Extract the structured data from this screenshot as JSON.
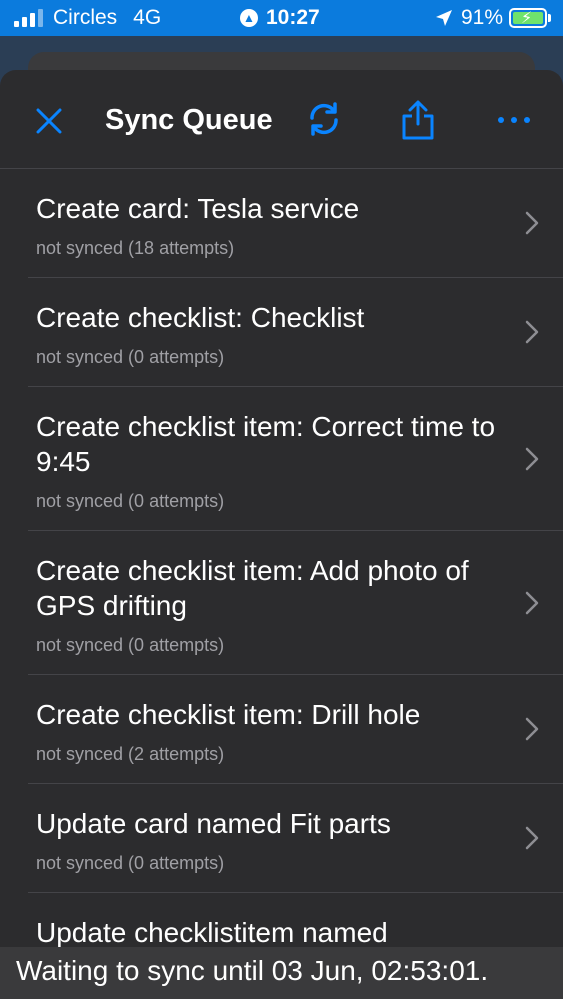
{
  "status_bar": {
    "carrier": "Circles",
    "network": "4G",
    "time": "10:27",
    "battery": "91%"
  },
  "header": {
    "title": "Sync Queue",
    "icons": [
      "close-icon",
      "refresh-icon",
      "share-icon",
      "more-icon"
    ]
  },
  "queue": {
    "items": [
      {
        "title": "Create card: Tesla service",
        "status": "not synced (18 attempts)"
      },
      {
        "title": "Create checklist: Checklist",
        "status": "not synced (0 attempts)"
      },
      {
        "title": "Create checklist item: Correct time to 9:45",
        "status": "not synced (0 attempts)"
      },
      {
        "title": "Create checklist item: Add photo of GPS drifting",
        "status": "not synced (0 attempts)"
      },
      {
        "title": "Create checklist item: Drill hole",
        "status": "not synced (2 attempts)"
      },
      {
        "title": "Update card named Fit parts",
        "status": "not synced (0 attempts)"
      },
      {
        "title": "Update checklistitem named",
        "status": ""
      }
    ]
  },
  "footer": {
    "message": "Waiting to sync until 03 Jun, 02:53:01."
  },
  "colors": {
    "accent": "#0a84ff",
    "status_bar": "#0b7bdd",
    "sheet": "#2c2c2e"
  }
}
